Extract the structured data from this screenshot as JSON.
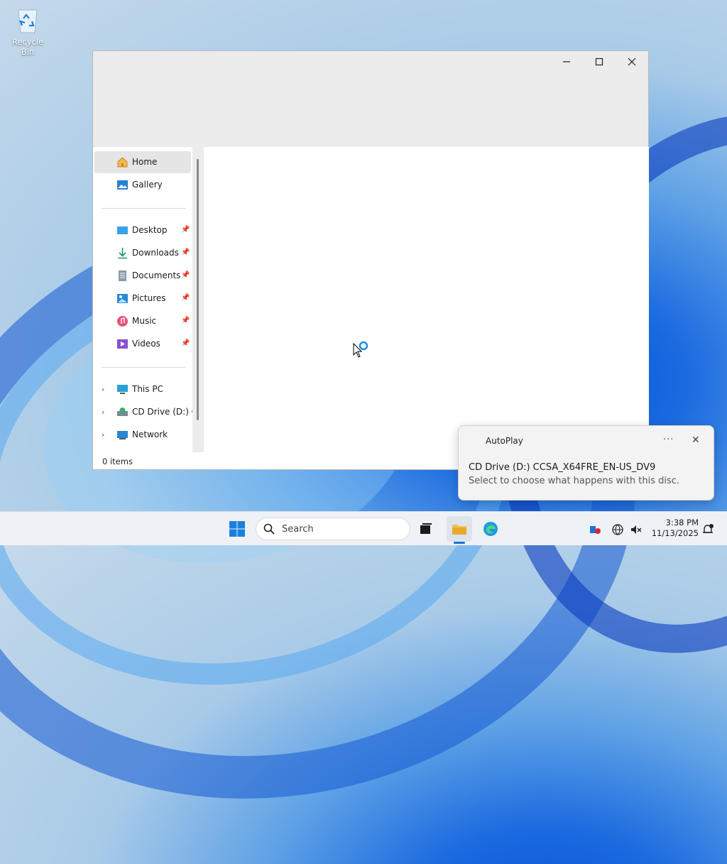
{
  "desktop": {
    "recycle_bin_label": "Recycle Bin"
  },
  "explorer": {
    "window_controls": {
      "minimize": "—",
      "maximize": "☐",
      "close": "✕"
    },
    "nav": {
      "home": "Home",
      "gallery": "Gallery",
      "pinned": [
        "Desktop",
        "Downloads",
        "Documents",
        "Pictures",
        "Music",
        "Videos"
      ],
      "this_pc": "This PC",
      "cd_drive": "CD Drive (D:) CC",
      "network": "Network"
    },
    "status": "0 items"
  },
  "toast": {
    "app": "AutoPlay",
    "more": "···",
    "close": "✕",
    "title": "CD Drive (D:) CCSA_X64FRE_EN-US_DV9",
    "body": "Select to choose what happens with this disc."
  },
  "taskbar": {
    "search_placeholder": "Search",
    "time": "3:38 PM",
    "date": "11/13/2025"
  },
  "colors": {
    "accent": "#1a73d6",
    "nav_selected": "#e5e5e5"
  }
}
